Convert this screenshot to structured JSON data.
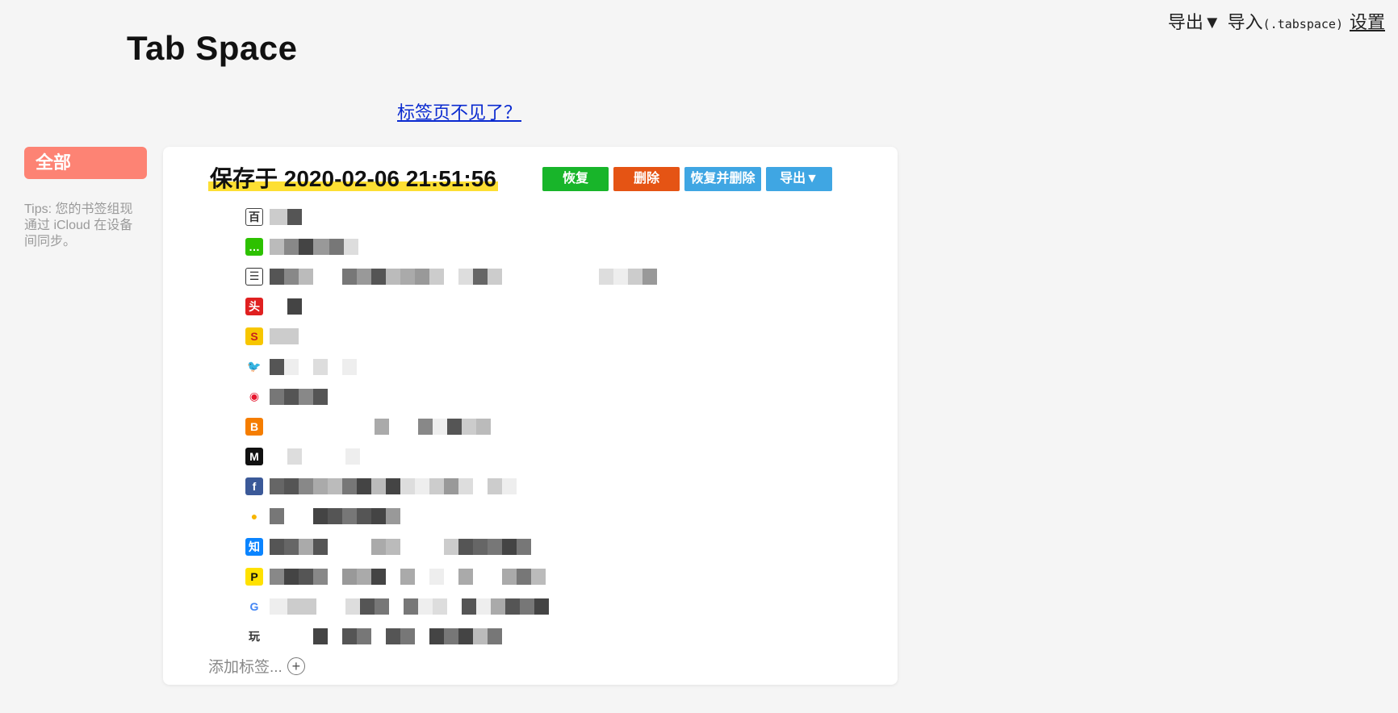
{
  "header": {
    "export_label": "导出▼",
    "import_label": "导入",
    "import_ext": "(.tabspace)",
    "settings_label": "设置"
  },
  "app": {
    "title": "Tab Space"
  },
  "missing_tabs_link": "标签页不见了？",
  "sidebar": {
    "all_label": "全部",
    "tips": "Tips: 您的书签组现通过 iCloud 在设备间同步。"
  },
  "group": {
    "title": "保存于 2020-02-06 21:51:56",
    "buttons": {
      "restore": "恢复",
      "delete": "删除",
      "restore_delete": "恢复并删除",
      "export": "导出▼"
    },
    "add_tab": "添加标签..."
  },
  "tab_icons": [
    {
      "name": "tab-site-icon",
      "glyph": "百",
      "bg": "#ffffff",
      "fg": "#333333",
      "border": "#444444"
    },
    {
      "name": "wechat-icon",
      "glyph": "…",
      "bg": "#2dc100",
      "fg": "#ffffff",
      "border": ""
    },
    {
      "name": "document-icon",
      "glyph": "☰",
      "bg": "#ffffff",
      "fg": "#333333",
      "border": "#333333"
    },
    {
      "name": "toutiao-icon",
      "glyph": "头",
      "bg": "#e02020",
      "fg": "#ffffff",
      "border": ""
    },
    {
      "name": "s-logo-icon",
      "glyph": "S",
      "bg": "#f7c600",
      "fg": "#c81e1e",
      "border": ""
    },
    {
      "name": "twitter-icon",
      "glyph": "🐦",
      "bg": "#ffffff",
      "fg": "#1da1f2",
      "border": ""
    },
    {
      "name": "weibo-icon",
      "glyph": "◉",
      "bg": "#ffffff",
      "fg": "#e6162d",
      "border": ""
    },
    {
      "name": "blogger-icon",
      "glyph": "B",
      "bg": "#f57d00",
      "fg": "#ffffff",
      "border": ""
    },
    {
      "name": "medium-icon",
      "glyph": "M",
      "bg": "#111111",
      "fg": "#ffffff",
      "border": ""
    },
    {
      "name": "facebook-icon",
      "glyph": "f",
      "bg": "#3b5998",
      "fg": "#ffffff",
      "border": ""
    },
    {
      "name": "qq-icon",
      "glyph": "●",
      "bg": "#ffffff",
      "fg": "#f7b500",
      "border": ""
    },
    {
      "name": "zhihu-icon",
      "glyph": "知",
      "bg": "#0a84ff",
      "fg": "#ffffff",
      "border": ""
    },
    {
      "name": "p-logo-icon",
      "glyph": "P",
      "bg": "#ffe100",
      "fg": "#111111",
      "border": ""
    },
    {
      "name": "google-icon",
      "glyph": "G",
      "bg": "#ffffff",
      "fg": "#4285f4",
      "border": ""
    },
    {
      "name": "wan-icon",
      "glyph": "玩",
      "bg": "#ffffff",
      "fg": "#333333",
      "border": ""
    }
  ]
}
